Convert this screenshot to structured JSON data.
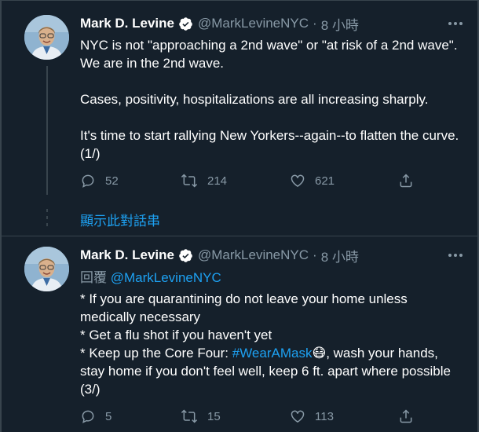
{
  "colors": {
    "background": "#15202b",
    "text_primary": "#ffffff",
    "text_secondary": "#8899a6",
    "accent": "#1da1f2",
    "border": "#38444d"
  },
  "tweets": [
    {
      "author_name": "Mark D. Levine",
      "handle": "@MarkLevineNYC",
      "separator": "·",
      "time": "8 小時",
      "text": "NYC is not \"approaching a 2nd wave\" or \"at risk of a 2nd wave\". We are in the 2nd wave.\n\nCases, positivity, hospitalizations are all increasing sharply.\n\nIt's time to start rallying New Yorkers--again--to flatten the curve. (1/)",
      "replies": "52",
      "retweets": "214",
      "likes": "621"
    },
    {
      "author_name": "Mark D. Levine",
      "handle": "@MarkLevineNYC",
      "separator": "·",
      "time": "8 小時",
      "reply_label": "回覆",
      "reply_to": "@MarkLevineNYC",
      "text_1": "* If you are quarantining do not leave your home unless medically necessary\n* Get a flu shot if you haven't yet\n* Keep up the Core Four: ",
      "hashtag": "#WearAMask",
      "emoji": "😷",
      "text_2": ", wash your hands, stay home if you don't feel well, keep 6 ft. apart where possible (3/)",
      "replies": "5",
      "retweets": "15",
      "likes": "113"
    }
  ],
  "show_thread_label": "顯示此對話串",
  "icons": [
    "verified-badge-icon",
    "more-icon",
    "reply-icon",
    "retweet-icon",
    "like-icon",
    "share-icon"
  ]
}
